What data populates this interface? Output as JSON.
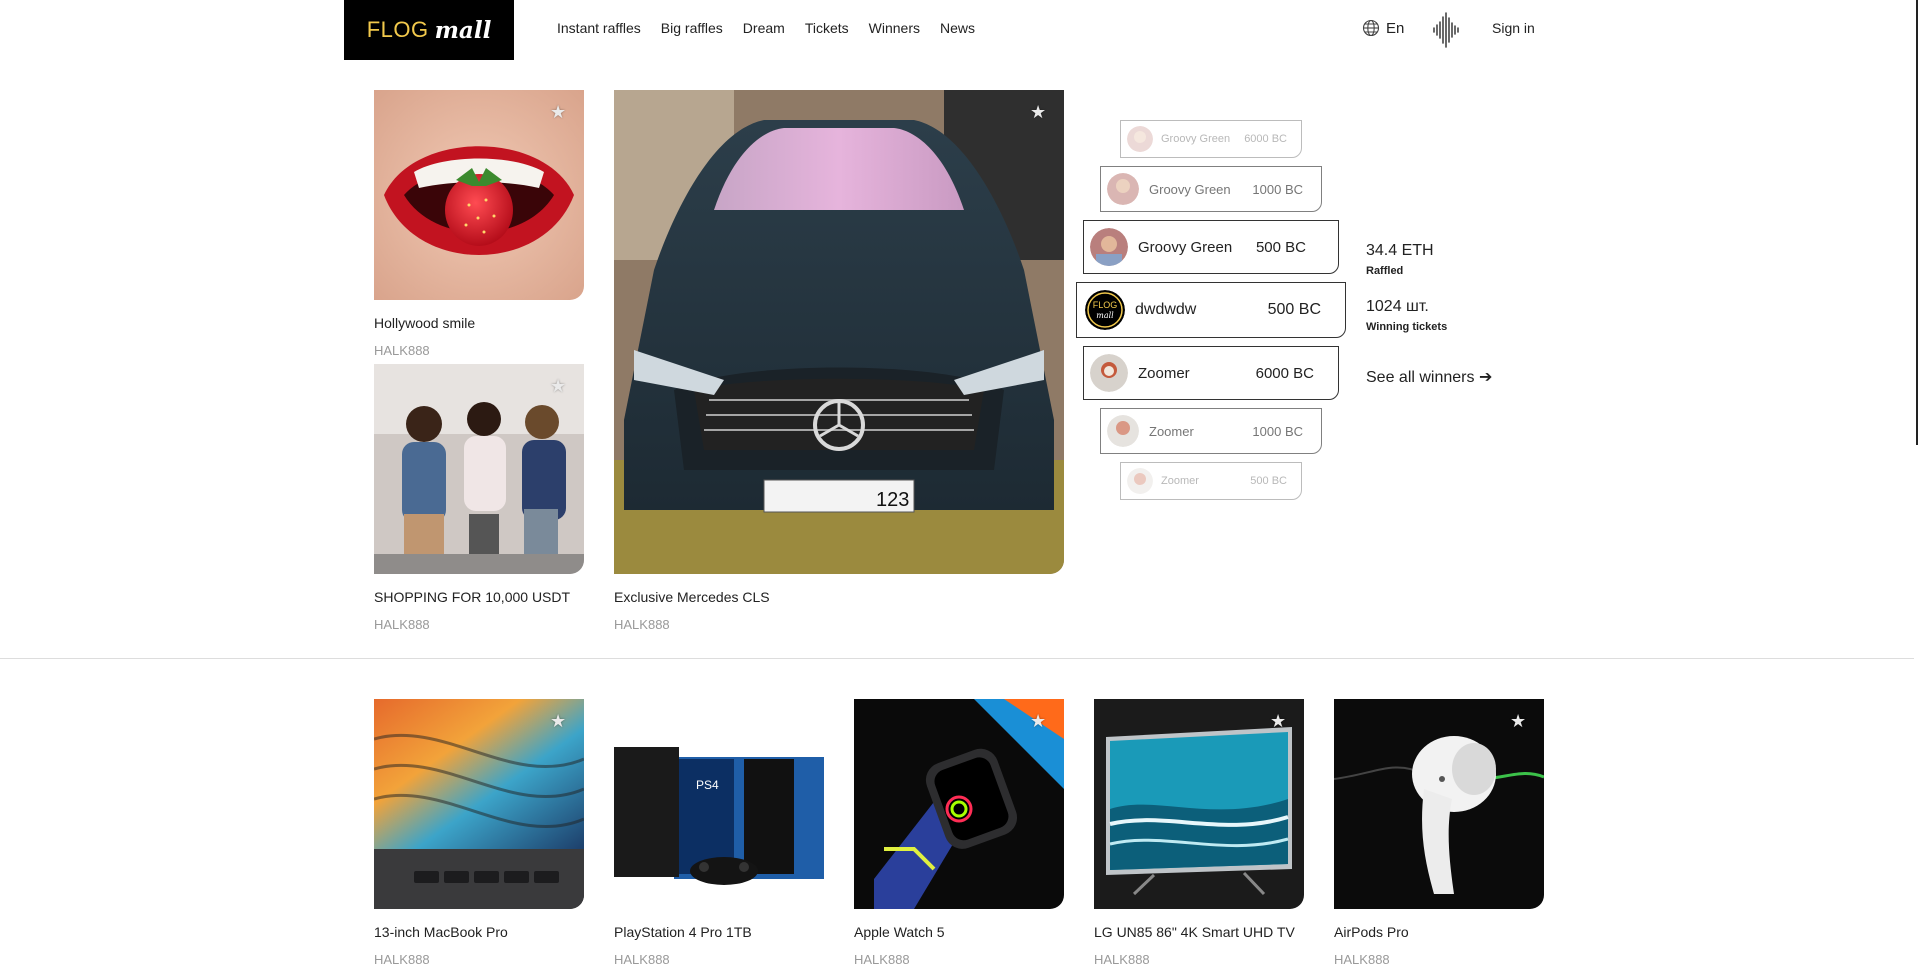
{
  "header": {
    "brand_left": "FLOG",
    "brand_right": "mall",
    "nav": [
      "Instant raffles",
      "Big raffles",
      "Dream",
      "Tickets",
      "Winners",
      "News"
    ],
    "language": "En",
    "signin": "Sign in"
  },
  "featured": [
    {
      "title": "Hollywood smile",
      "owner": "HALK888"
    },
    {
      "title": "SHOPPING FOR 10,000 USDT",
      "owner": "HALK888"
    },
    {
      "title": "Exclusive Mercedes CLS",
      "owner": "HALK888"
    }
  ],
  "car_plate": "123",
  "winners": [
    {
      "name": "Groovy Green",
      "amount": "6000 BC"
    },
    {
      "name": "Groovy Green",
      "amount": "1000 BC"
    },
    {
      "name": "Groovy Green",
      "amount": "500 BC"
    },
    {
      "name": "dwdwdw",
      "amount": "500 BC"
    },
    {
      "name": "Zoomer",
      "amount": "6000 BC"
    },
    {
      "name": "Zoomer",
      "amount": "1000 BC"
    },
    {
      "name": "Zoomer",
      "amount": "500 BC"
    }
  ],
  "stats": {
    "raffled_value": "34.4 ETH",
    "raffled_label": "Raffled",
    "tickets_value": "1024 шт.",
    "tickets_label": "Winning tickets",
    "see_all": "See all winners ➔"
  },
  "products": [
    {
      "title": "13-inch MacBook Pro",
      "owner": "HALK888"
    },
    {
      "title": "PlayStation 4 Pro 1TB",
      "owner": "HALK888"
    },
    {
      "title": "Apple Watch 5",
      "owner": "HALK888"
    },
    {
      "title": "LG UN85 86\" 4K Smart UHD TV",
      "owner": "HALK888"
    },
    {
      "title": "AirPods Pro",
      "owner": "HALK888"
    }
  ],
  "colors": {
    "brand_yellow": "#f2c94c",
    "logo_bg": "#000000",
    "star": "#eaeaea"
  }
}
